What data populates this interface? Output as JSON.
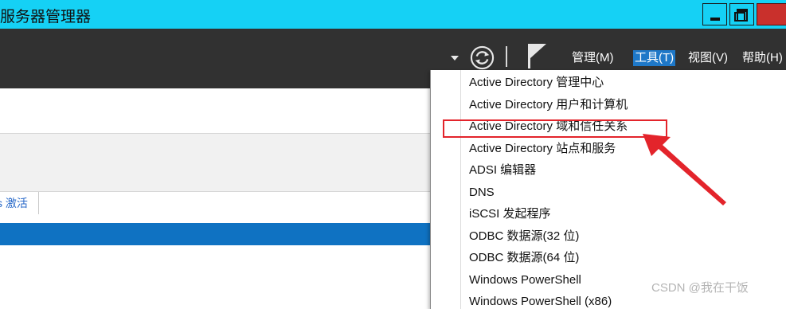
{
  "window": {
    "title": "服务器管理器",
    "buttons": [
      "minimize",
      "maximize",
      "close"
    ]
  },
  "toolbar": {
    "icons": [
      "dropdown-caret-icon",
      "refresh-icon",
      "flag-icon"
    ],
    "menus": [
      {
        "label": "管理(M)",
        "active": false
      },
      {
        "label": "工具(T)",
        "active": true
      },
      {
        "label": "视图(V)",
        "active": false
      },
      {
        "label": "帮助(H)",
        "active": false
      }
    ]
  },
  "left_panel": {
    "tab_label": "s 激活"
  },
  "tools_menu": {
    "items": [
      "Active Directory 管理中心",
      "Active Directory 用户和计算机",
      "Active Directory 域和信任关系",
      "Active Directory 站点和服务",
      "ADSI 编辑器",
      "DNS",
      "iSCSI 发起程序",
      "ODBC 数据源(32 位)",
      "ODBC 数据源(64 位)",
      "Windows PowerShell",
      "Windows PowerShell (x86)"
    ],
    "highlighted_item": "Active Directory 域和信任关系"
  },
  "annotation": {
    "color": "#e3242b"
  },
  "watermark": "CSDN @我在干饭",
  "colors": {
    "titlebar": "#15d1f5",
    "command_bar": "#313131",
    "menu_active": "#1e78c8",
    "selected_row": "#0f72c2"
  }
}
